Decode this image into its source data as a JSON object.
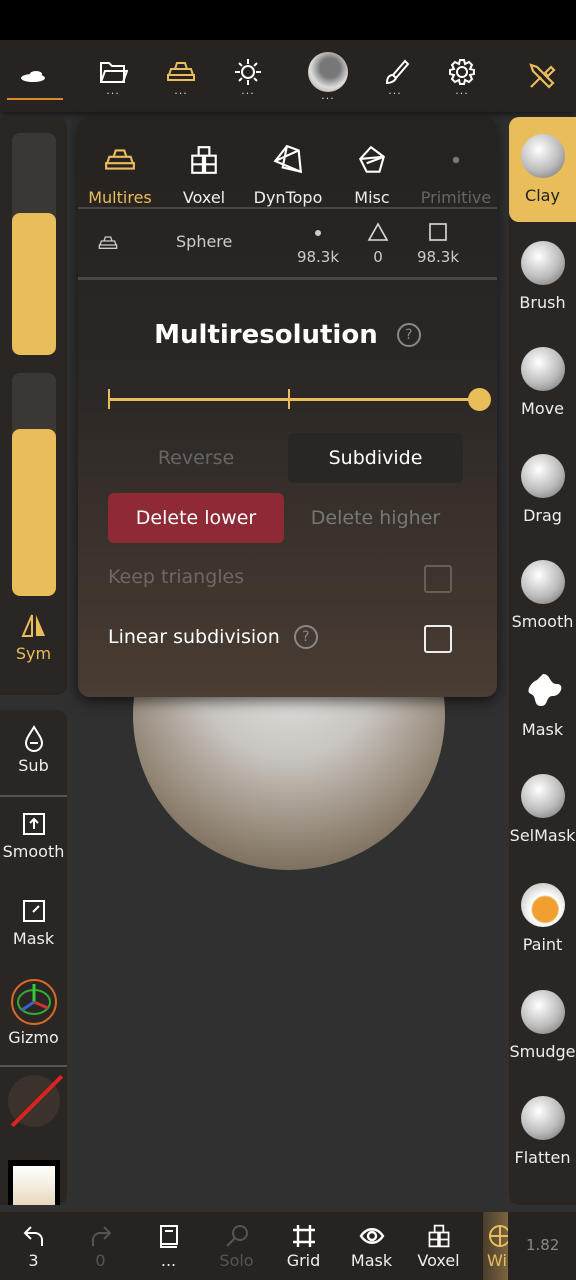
{
  "colors": {
    "accent": "#e8bd5a",
    "danger": "#8e2a35",
    "panel": "#2a2624"
  },
  "topbar": {
    "items": [
      {
        "icon": "scene-icon"
      },
      {
        "icon": "folder-icon",
        "more": "..."
      },
      {
        "icon": "multires-icon",
        "more": "..."
      },
      {
        "icon": "light-icon",
        "more": "..."
      },
      {
        "icon": "material-ball-icon",
        "more": "..."
      },
      {
        "icon": "brush-icon",
        "more": "..."
      },
      {
        "icon": "settings-icon",
        "more": "..."
      },
      {
        "icon": "tools-icon"
      }
    ]
  },
  "left": {
    "radius_fraction": 0.64,
    "intensity_fraction": 0.75,
    "sym": "Sym",
    "sub": "Sub",
    "smooth": "Smooth",
    "mask": "Mask",
    "gizmo": "Gizmo"
  },
  "right": {
    "tools": [
      "Clay",
      "Brush",
      "Move",
      "Drag",
      "Smooth",
      "Mask",
      "SelMask",
      "Paint",
      "Smudge",
      "Flatten"
    ],
    "active": "Clay"
  },
  "popup": {
    "tabs": [
      "Multires",
      "Voxel",
      "DynTopo",
      "Misc",
      "Primitive"
    ],
    "mesh": {
      "name": "Sphere",
      "vertices": "98.3k",
      "triangles": "0",
      "quads": "98.3k"
    },
    "title": "Multiresolution",
    "help": "?",
    "level_fraction": 1.0,
    "reverse": "Reverse",
    "subdivide": "Subdivide",
    "delete_lower": "Delete lower",
    "delete_higher": "Delete higher",
    "keep_triangles": "Keep triangles",
    "linear_subdivision": "Linear subdivision"
  },
  "bottom": {
    "undo": "3",
    "redo": "0",
    "more": "...",
    "solo": "Solo",
    "grid": "Grid",
    "mask": "Mask",
    "voxel": "Voxel",
    "wire": "Wi",
    "fps": "1.82"
  }
}
